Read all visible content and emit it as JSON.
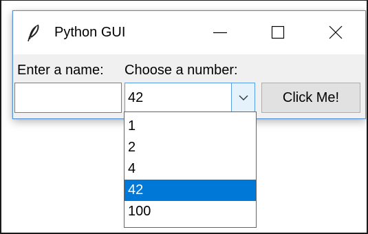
{
  "window": {
    "title": "Python GUI",
    "app_icon": "feather-icon",
    "controls": {
      "minimize_icon": "minimize-icon",
      "maximize_icon": "maximize-icon",
      "close_icon": "close-icon"
    }
  },
  "form": {
    "name_label": "Enter a name:",
    "number_label": "Choose a number:",
    "name_value": "",
    "combo_value": "42",
    "combo_icon": "chevron-down-icon",
    "button_label": "Click Me!"
  },
  "dropdown": {
    "options": [
      "1",
      "2",
      "4",
      "42",
      "100"
    ],
    "selected": "42"
  },
  "colors": {
    "selection": "#0078d7",
    "focus_border": "#569de5",
    "window_bg": "#f0f0f0"
  }
}
